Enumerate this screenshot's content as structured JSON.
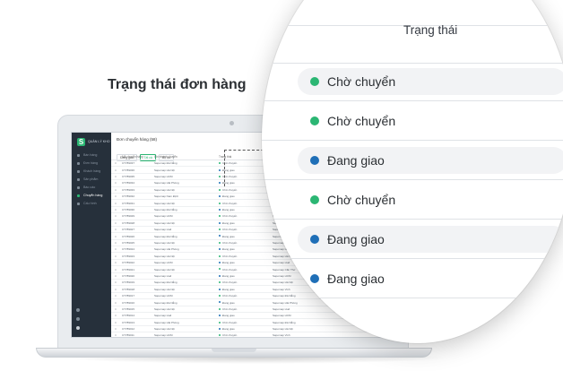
{
  "headline": "Trạng thái đơn hàng",
  "colors": {
    "waiting": "#2bb673",
    "shipping": "#1f6fb7",
    "sidebar": "#26303b"
  },
  "app": {
    "brand": "QUẢN LÝ KHO",
    "page_title": "Đơn chuyển hàng (58)",
    "tabs": [
      "Đang giao",
      "Tất cả",
      "Bộ lọc"
    ],
    "sidebar": [
      "Bán hàng",
      "Đơn hàng",
      "Khách hàng",
      "Sản phẩm",
      "Báo cáo",
      "Chuyển hàng",
      "Cấu hình"
    ],
    "active_sidebar_index": 5,
    "columns": [
      "Mã chuyển hàng",
      "Chi nhánh chuyển",
      "Trạng thái",
      "Chi nhánh nhận"
    ],
    "rows": [
      {
        "code": "CT789037",
        "from": "Sapomap Đà Nẵng",
        "status": "Chờ chuyển",
        "to": "Sapomap Hà Nội"
      },
      {
        "code": "CT789036",
        "from": "Sapomap Hà Nội",
        "status": "Đang giao",
        "to": "Sapomap Thái Bình"
      },
      {
        "code": "CT789035",
        "from": "Sapomap HCM",
        "status": "Chờ chuyển",
        "to": "Sapomap Huế"
      },
      {
        "code": "CT789034",
        "from": "Sapomap Hải Phòng",
        "status": "Đang giao",
        "to": "Sapomap Huế"
      },
      {
        "code": "CT789033",
        "from": "Sapomap Hà Nội",
        "status": "Chờ chuyển",
        "to": "Sapomap Đà Nẵng"
      },
      {
        "code": "CT789032",
        "from": "Sapomap Nam Định",
        "status": "Đang giao",
        "to": "Sapomap HCM"
      },
      {
        "code": "CT789031",
        "from": "Sapomap Hà Nội",
        "status": "Chờ chuyển",
        "to": "Sapomap Cần Thơ"
      },
      {
        "code": "CT789030",
        "from": "Sapomap Đà Nẵng",
        "status": "Đang giao",
        "to": "Sapomap Hải Phòng"
      },
      {
        "code": "CT789029",
        "from": "Sapomap HCM",
        "status": "Chờ chuyển",
        "to": "Sapomap Vinh"
      },
      {
        "code": "CT789028",
        "from": "Sapomap Hà Nội",
        "status": "Đang giao",
        "to": "Sapomap Hà Nội"
      },
      {
        "code": "CT789027",
        "from": "Sapomap Huế",
        "status": "Chờ chuyển",
        "to": "Sapomap Huế"
      },
      {
        "code": "CT789026",
        "from": "Sapomap Đà Nẵng",
        "status": "Đang giao",
        "to": "Sapomap HCM"
      },
      {
        "code": "CT789025",
        "from": "Sapomap Hà Nội",
        "status": "Chờ chuyển",
        "to": "Sapomap Đà Nẵng"
      },
      {
        "code": "CT789024",
        "from": "Sapomap Hải Phòng",
        "status": "Đang giao",
        "to": "Sapomap Hà Nội"
      },
      {
        "code": "CT789023",
        "from": "Sapomap Hà Nội",
        "status": "Chờ chuyển",
        "to": "Sapomap Hà Nội"
      },
      {
        "code": "CT789022",
        "from": "Sapomap HCM",
        "status": "Đang giao",
        "to": "Sapomap Huế"
      },
      {
        "code": "CT789021",
        "from": "Sapomap Hà Nội",
        "status": "Chờ chuyển",
        "to": "Sapomap Cần Thơ"
      },
      {
        "code": "CT789020",
        "from": "Sapomap Huế",
        "status": "Đang giao",
        "to": "Sapomap HCM"
      },
      {
        "code": "CT789019",
        "from": "Sapomap Đà Nẵng",
        "status": "Chờ chuyển",
        "to": "Sapomap Hà Nội"
      },
      {
        "code": "CT789018",
        "from": "Sapomap Hà Nội",
        "status": "Đang giao",
        "to": "Sapomap Vinh"
      },
      {
        "code": "CT789017",
        "from": "Sapomap HCM",
        "status": "Chờ chuyển",
        "to": "Sapomap Đà Nẵng"
      },
      {
        "code": "CT789016",
        "from": "Sapomap Đà Nẵng",
        "status": "Đang giao",
        "to": "Sapomap Hải Phòng"
      },
      {
        "code": "CT789015",
        "from": "Sapomap Hà Nội",
        "status": "Chờ chuyển",
        "to": "Sapomap Huế"
      },
      {
        "code": "CT789014",
        "from": "Sapomap Huế",
        "status": "Đang giao",
        "to": "Sapomap HCM"
      },
      {
        "code": "CT789013",
        "from": "Sapomap Hải Phòng",
        "status": "Chờ chuyển",
        "to": "Sapomap Đà Nẵng"
      },
      {
        "code": "CT789012",
        "from": "Sapomap Hà Nội",
        "status": "Đang giao",
        "to": "Sapomap Hà Nội"
      },
      {
        "code": "CT789011",
        "from": "Sapomap HCM",
        "status": "Chờ chuyển",
        "to": "Sapomap Vinh"
      },
      {
        "code": "CT789010",
        "from": "Sapomap Bình Định",
        "status": "Đang giao",
        "to": "Sapomap HCM"
      },
      {
        "code": "CT789009",
        "from": "Sapomap Đà Nẵng",
        "status": "Chờ chuyển",
        "to": "Sapomap Hà Nội"
      },
      {
        "code": "CT789008",
        "from": "Sapomap Hà Nội",
        "status": "Đang giao",
        "to": "Sapomap Huế"
      }
    ]
  },
  "lens": {
    "header": "Trạng thái",
    "rows": [
      {
        "label": "Chờ chuyển",
        "state": "waiting"
      },
      {
        "label": "Chờ chuyển",
        "state": "waiting"
      },
      {
        "label": "Đang giao",
        "state": "shipping"
      },
      {
        "label": "Chờ chuyển",
        "state": "waiting"
      },
      {
        "label": "Đang giao",
        "state": "shipping"
      },
      {
        "label": "Đang giao",
        "state": "shipping"
      }
    ]
  }
}
